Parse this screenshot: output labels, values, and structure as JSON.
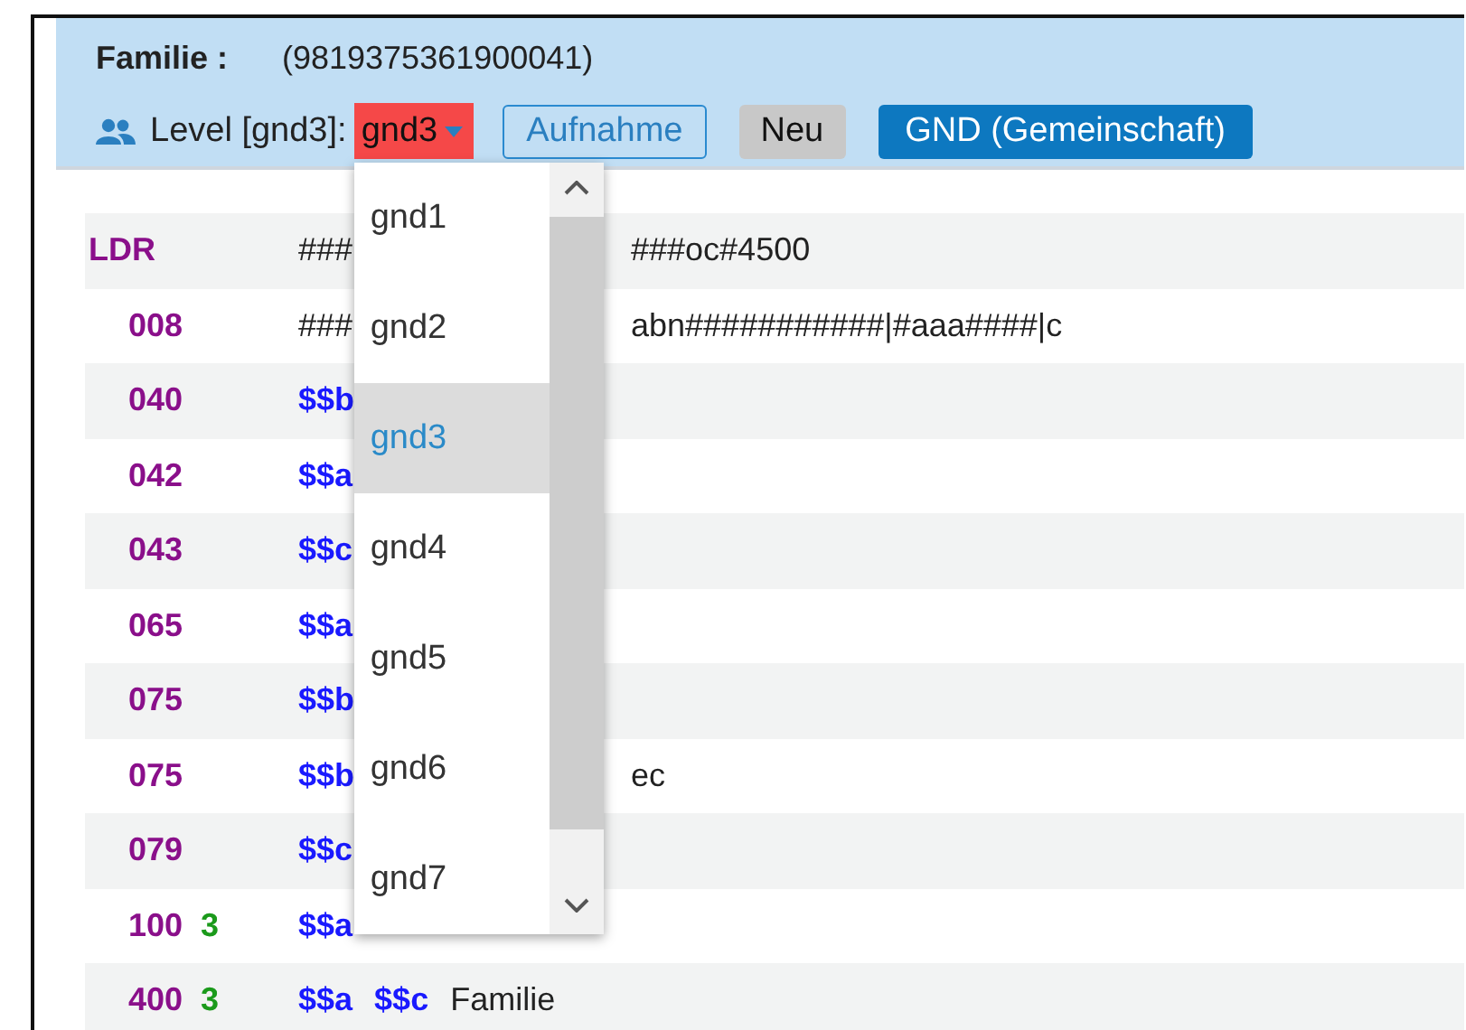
{
  "header": {
    "label": "Familie :",
    "value": "(9819375361900041)",
    "level_label": "Level [gnd3]:",
    "level_select": {
      "value": "gnd3"
    },
    "buttons": [
      {
        "label": "Aufnahme",
        "kind": "outline"
      },
      {
        "label": "Neu",
        "kind": "grey"
      },
      {
        "label": "GND (Gemeinschaft)",
        "kind": "primary"
      }
    ]
  },
  "rows": [
    {
      "tag": "LDR",
      "left": [
        {
          "kind": "text",
          "text": "###"
        }
      ],
      "right": "###oc#4500"
    },
    {
      "tag": "008",
      "left": [
        {
          "kind": "text",
          "text": "###"
        }
      ],
      "right": "abn###########|#aaa####|c"
    },
    {
      "tag": "040",
      "left": [
        {
          "kind": "code",
          "text": "$$b"
        }
      ]
    },
    {
      "tag": "042",
      "left": [
        {
          "kind": "code",
          "text": "$$a"
        }
      ]
    },
    {
      "tag": "043",
      "left": [
        {
          "kind": "code",
          "text": "$$c"
        }
      ]
    },
    {
      "tag": "065",
      "left": [
        {
          "kind": "code",
          "text": "$$a"
        }
      ]
    },
    {
      "tag": "075",
      "left": [
        {
          "kind": "code",
          "text": "$$b"
        }
      ]
    },
    {
      "tag": "075",
      "left": [
        {
          "kind": "code",
          "text": "$$b"
        }
      ],
      "right": "ec"
    },
    {
      "tag": "079",
      "left": [
        {
          "kind": "code",
          "text": "$$c"
        }
      ]
    },
    {
      "tag": "100",
      "indicator": "3",
      "left": [
        {
          "kind": "code",
          "text": "$$a"
        }
      ]
    },
    {
      "tag": "400",
      "indicator": "3",
      "left": [
        {
          "kind": "code",
          "text": "$$a"
        },
        {
          "kind": "code",
          "text": "$$c"
        },
        {
          "kind": "text",
          "text": "Familie"
        }
      ]
    }
  ],
  "dropdown": {
    "options": [
      {
        "label": "gnd1",
        "selected": false
      },
      {
        "label": "gnd2",
        "selected": false
      },
      {
        "label": "gnd3",
        "selected": true
      },
      {
        "label": "gnd4",
        "selected": false
      },
      {
        "label": "gnd5",
        "selected": false
      },
      {
        "label": "gnd6",
        "selected": false
      },
      {
        "label": "gnd7",
        "selected": false
      }
    ]
  }
}
